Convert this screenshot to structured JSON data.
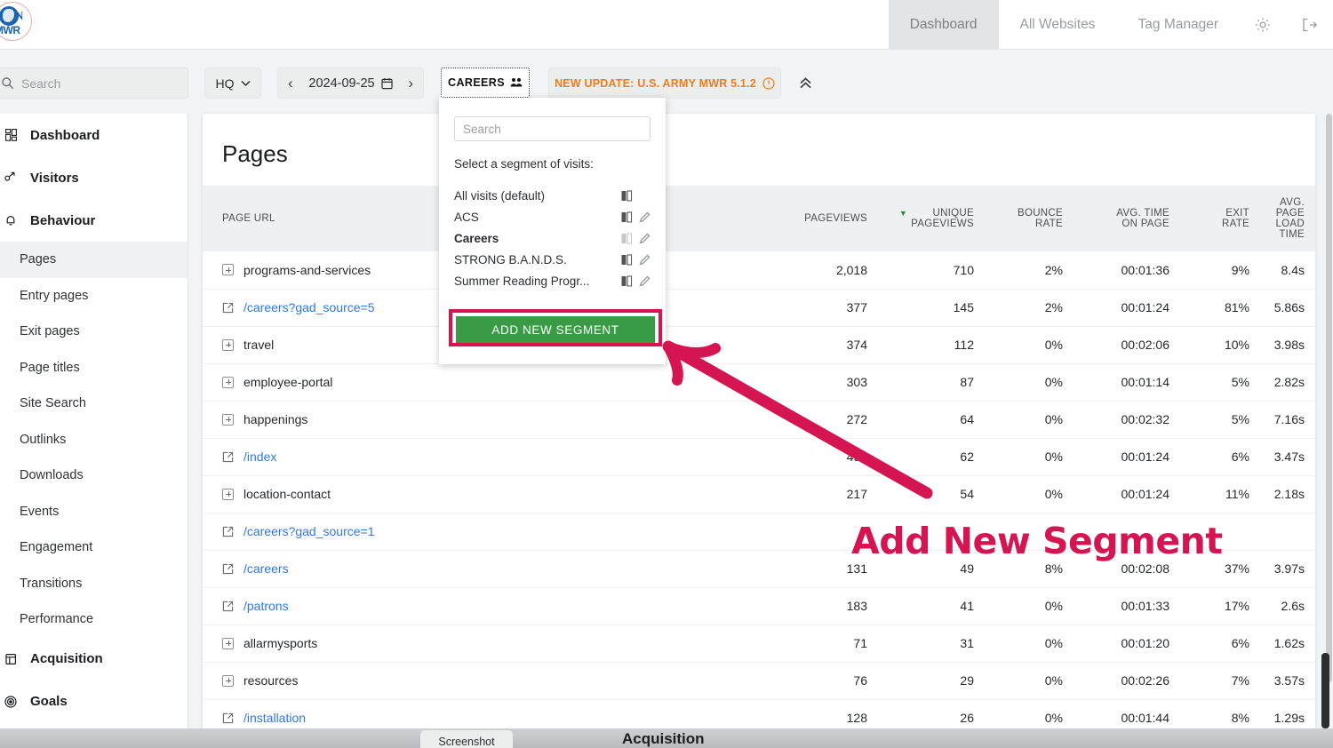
{
  "topnav": {
    "items": [
      {
        "label": "Dashboard",
        "active": true
      },
      {
        "label": "All Websites",
        "active": false
      },
      {
        "label": "Tag Manager",
        "active": false
      }
    ],
    "gear_icon": "gear-icon",
    "signout_icon": "sign-out-icon"
  },
  "logo": {
    "text": "MWR",
    "letter": "N"
  },
  "controls": {
    "search_placeholder": "Search",
    "site_selector": "HQ",
    "date": "2024-09-25",
    "segment_button": "CAREERS",
    "update_badge": "NEW UPDATE: U.S. ARMY MWR 5.1.2"
  },
  "sidebar": {
    "groups": [
      {
        "label": "Dashboard",
        "icon": "dashboard-icon",
        "children": []
      },
      {
        "label": "Visitors",
        "icon": "visitors-icon",
        "children": []
      },
      {
        "label": "Behaviour",
        "icon": "behaviour-icon",
        "children": [
          {
            "label": "Pages",
            "active": true
          },
          {
            "label": "Entry pages",
            "active": false
          },
          {
            "label": "Exit pages",
            "active": false
          },
          {
            "label": "Page titles",
            "active": false
          },
          {
            "label": "Site Search",
            "active": false
          },
          {
            "label": "Outlinks",
            "active": false
          },
          {
            "label": "Downloads",
            "active": false
          },
          {
            "label": "Events",
            "active": false
          },
          {
            "label": "Engagement",
            "active": false
          },
          {
            "label": "Transitions",
            "active": false
          },
          {
            "label": "Performance",
            "active": false
          }
        ]
      },
      {
        "label": "Acquisition",
        "icon": "acquisition-icon",
        "children": []
      },
      {
        "label": "Goals",
        "icon": "goals-icon",
        "children": []
      }
    ]
  },
  "panel": {
    "title": "Pages",
    "columns": [
      {
        "label": "PAGE URL",
        "sorted": false
      },
      {
        "label": "PAGEVIEWS",
        "sorted": false
      },
      {
        "label": "UNIQUE\nPAGEVIEWS",
        "sorted": true
      },
      {
        "label": "BOUNCE\nRATE",
        "sorted": false
      },
      {
        "label": "AVG. TIME\nON PAGE",
        "sorted": false
      },
      {
        "label": "EXIT\nRATE",
        "sorted": false
      },
      {
        "label": "AVG.\nPAGE\nLOAD\nTIME",
        "sorted": false
      }
    ],
    "rows": [
      {
        "url": "programs-and-services",
        "type": "folder",
        "pageviews": "2,018",
        "unique": "710",
        "bounce": "2%",
        "avgtime": "00:01:36",
        "exit": "9%",
        "load": "8.4s"
      },
      {
        "url": "/careers?gad_source=5",
        "type": "link",
        "pageviews": "377",
        "unique": "145",
        "bounce": "2%",
        "avgtime": "00:01:24",
        "exit": "81%",
        "load": "5.86s"
      },
      {
        "url": "travel",
        "type": "folder",
        "pageviews": "374",
        "unique": "112",
        "bounce": "0%",
        "avgtime": "00:02:06",
        "exit": "10%",
        "load": "3.98s"
      },
      {
        "url": "employee-portal",
        "type": "folder",
        "pageviews": "303",
        "unique": "87",
        "bounce": "0%",
        "avgtime": "00:01:14",
        "exit": "5%",
        "load": "2.82s"
      },
      {
        "url": "happenings",
        "type": "folder",
        "pageviews": "272",
        "unique": "64",
        "bounce": "0%",
        "avgtime": "00:02:32",
        "exit": "5%",
        "load": "7.16s"
      },
      {
        "url": "/index",
        "type": "link",
        "pageviews": "490",
        "unique": "62",
        "bounce": "0%",
        "avgtime": "00:01:24",
        "exit": "6%",
        "load": "3.47s"
      },
      {
        "url": "location-contact",
        "type": "folder",
        "pageviews": "217",
        "unique": "54",
        "bounce": "0%",
        "avgtime": "00:01:24",
        "exit": "11%",
        "load": "2.18s"
      },
      {
        "url": "/careers?gad_source=1",
        "type": "link",
        "pageviews": "",
        "unique": "",
        "bounce": "",
        "avgtime": "",
        "exit": "",
        "load": ""
      },
      {
        "url": "/careers",
        "type": "link",
        "pageviews": "131",
        "unique": "49",
        "bounce": "8%",
        "avgtime": "00:02:08",
        "exit": "37%",
        "load": "3.97s"
      },
      {
        "url": "/patrons",
        "type": "link",
        "pageviews": "183",
        "unique": "41",
        "bounce": "0%",
        "avgtime": "00:01:33",
        "exit": "17%",
        "load": "2.6s"
      },
      {
        "url": "allarmysports",
        "type": "folder",
        "pageviews": "71",
        "unique": "31",
        "bounce": "0%",
        "avgtime": "00:01:20",
        "exit": "6%",
        "load": "1.62s"
      },
      {
        "url": "resources",
        "type": "folder",
        "pageviews": "76",
        "unique": "29",
        "bounce": "0%",
        "avgtime": "00:02:26",
        "exit": "7%",
        "load": "3.57s"
      },
      {
        "url": "/installation",
        "type": "link",
        "pageviews": "128",
        "unique": "26",
        "bounce": "0%",
        "avgtime": "00:01:44",
        "exit": "8%",
        "load": "1.29s"
      }
    ]
  },
  "dropdown": {
    "search_placeholder": "Search",
    "label": "Select a segment of visits:",
    "segments": [
      {
        "name": "All visits (default)",
        "selected": false,
        "editable": false,
        "dim": false
      },
      {
        "name": "ACS",
        "selected": false,
        "editable": true,
        "dim": false
      },
      {
        "name": "Careers",
        "selected": true,
        "editable": true,
        "dim": true
      },
      {
        "name": "STRONG B.A.N.D.S.",
        "selected": false,
        "editable": true,
        "dim": false
      },
      {
        "name": "Summer Reading Progr...",
        "selected": false,
        "editable": true,
        "dim": false
      }
    ],
    "add_button": "ADD NEW SEGMENT"
  },
  "annotation": {
    "text": "Add New Segment",
    "color": "#d41552"
  },
  "bottom": {
    "tab_label": "Screenshot",
    "title": "Acquisition"
  }
}
